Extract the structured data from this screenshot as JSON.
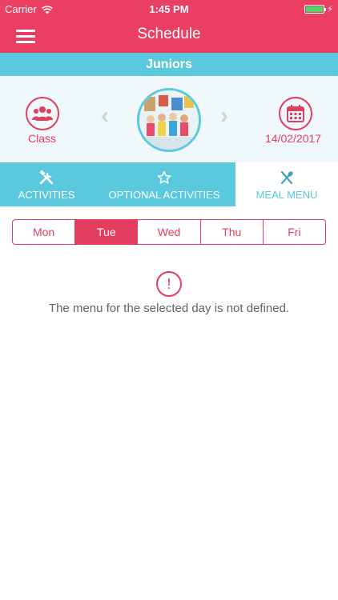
{
  "status_bar": {
    "carrier": "Carrier",
    "time": "1:45 PM",
    "battery_color": "#4cd964"
  },
  "header": {
    "title": "Schedule",
    "menu_icon": "hamburger-menu-icon",
    "color": "#ea3f63"
  },
  "group": {
    "name": "Juniors",
    "color": "#5bc9dd"
  },
  "info": {
    "class_label": "Class",
    "class_icon": "users-group-icon",
    "date": "14/02/2017",
    "date_icon": "calendar-icon",
    "prev_icon": "chevron-left-icon",
    "next_icon": "chevron-right-icon"
  },
  "tabs": [
    {
      "label": "ACTIVITIES",
      "icon": "tools-icon",
      "active": false
    },
    {
      "label": "OPTIONAL ACTIVITIES",
      "icon": "star-outline-icon",
      "active": false
    },
    {
      "label": "MEAL MENU",
      "icon": "fork-spoon-icon",
      "active": true
    }
  ],
  "days": [
    {
      "label": "Mon",
      "active": false
    },
    {
      "label": "Tue",
      "active": true
    },
    {
      "label": "Wed",
      "active": false
    },
    {
      "label": "Thu",
      "active": false
    },
    {
      "label": "Fri",
      "active": false
    }
  ],
  "empty_state": {
    "icon": "exclamation-circle-icon",
    "message": "The menu for the selected day is not defined."
  }
}
